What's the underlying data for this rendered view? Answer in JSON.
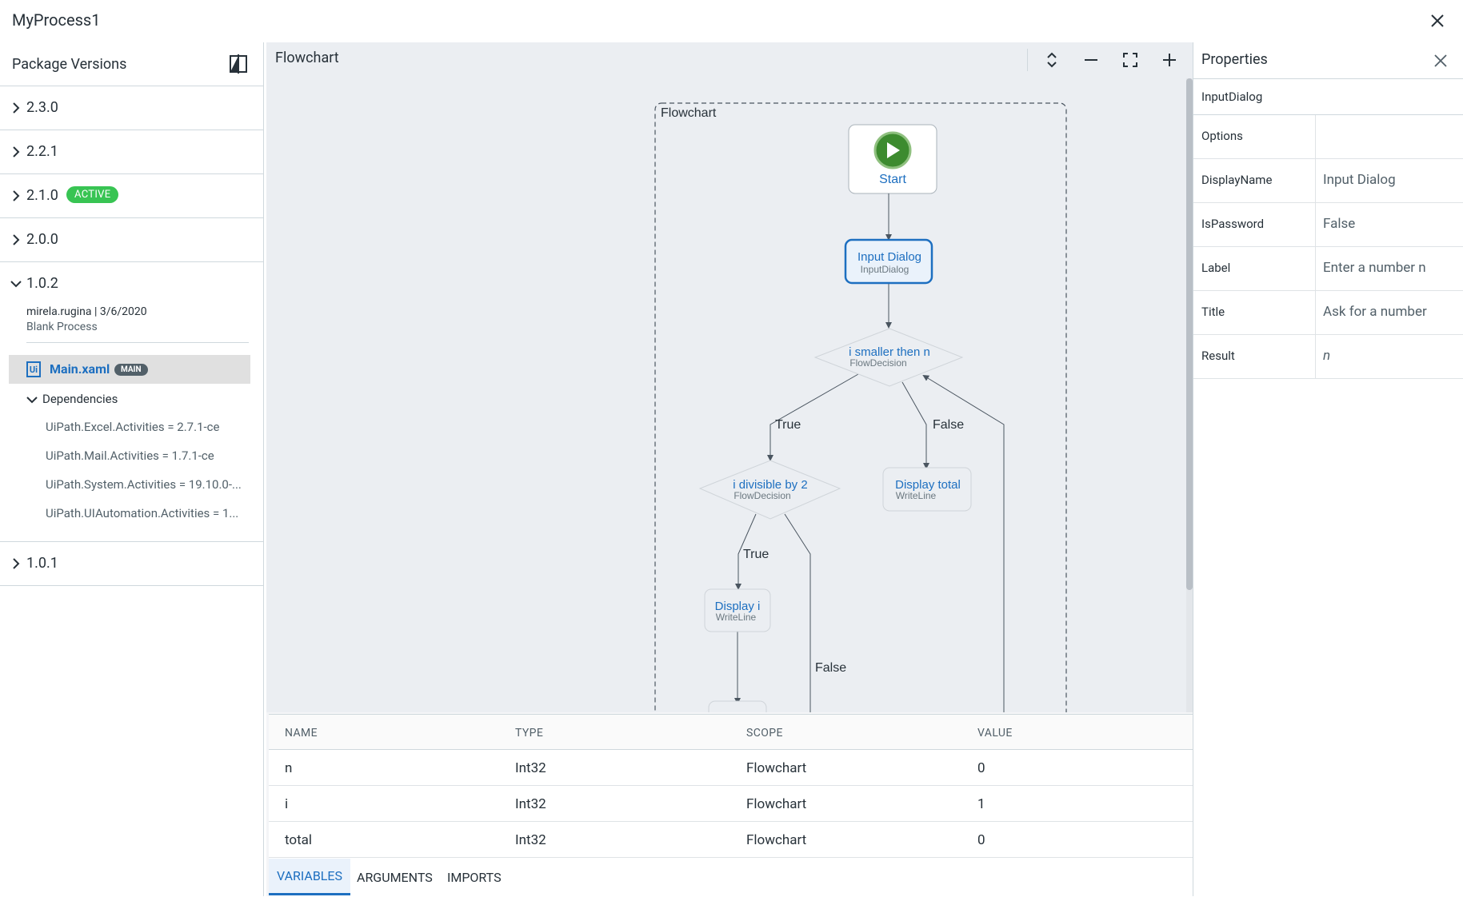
{
  "window": {
    "title": "MyProcess1"
  },
  "package_panel": {
    "title": "Package Versions",
    "versions": [
      {
        "label": "2.3.0"
      },
      {
        "label": "2.2.1"
      },
      {
        "label": "2.1.0",
        "badge": "ACTIVE"
      },
      {
        "label": "2.0.0"
      },
      {
        "label": "1.0.2",
        "expanded": true
      },
      {
        "label": "1.0.1"
      }
    ],
    "expanded_version": {
      "author_date": "mirela.rugina | 3/6/2020",
      "description": "Blank Process",
      "main_file": "Main.xaml",
      "main_badge": "MAIN",
      "dependencies_label": "Dependencies",
      "dependencies": [
        "UiPath.Excel.Activities = 2.7.1-ce",
        "UiPath.Mail.Activities = 1.7.1-ce",
        "UiPath.System.Activities = 19.10.0-...",
        "UiPath.UIAutomation.Activities = 1..."
      ]
    }
  },
  "designer": {
    "title": "Flowchart",
    "flowchart_label": "Flowchart",
    "nodes": {
      "start": "Start",
      "input_dialog": {
        "title": "Input Dialog",
        "type": "InputDialog"
      },
      "decision1": {
        "title": "i smaller then n",
        "type": "FlowDecision"
      },
      "decision2": {
        "title": "i divisible by 2",
        "type": "FlowDecision"
      },
      "display_total": {
        "title": "Display total",
        "type": "WriteLine"
      },
      "display_i": {
        "title": "Display i",
        "type": "WriteLine"
      }
    },
    "edge_labels": {
      "true1": "True",
      "false1": "False",
      "true2": "True",
      "false2": "False"
    }
  },
  "variables": {
    "headers": [
      "NAME",
      "TYPE",
      "SCOPE",
      "VALUE"
    ],
    "rows": [
      [
        "n",
        "Int32",
        "Flowchart",
        "0"
      ],
      [
        "i",
        "Int32",
        "Flowchart",
        "1"
      ],
      [
        "total",
        "Int32",
        "Flowchart",
        "0"
      ]
    ],
    "tabs": [
      "VARIABLES",
      "ARGUMENTS",
      "IMPORTS"
    ],
    "active_tab": "VARIABLES"
  },
  "properties": {
    "title": "Properties",
    "activity": "InputDialog",
    "rows": [
      {
        "key": "Options",
        "value": ""
      },
      {
        "key": "DisplayName",
        "value": "Input Dialog"
      },
      {
        "key": "IsPassword",
        "value": "False"
      },
      {
        "key": "Label",
        "value": "Enter a number n"
      },
      {
        "key": "Title",
        "value": "Ask for a number"
      },
      {
        "key": "Result",
        "value": "n"
      }
    ]
  },
  "colors": {
    "accent": "#1d6fc0",
    "active_badge": "#38c453",
    "start_green": "#3d8b2f"
  }
}
